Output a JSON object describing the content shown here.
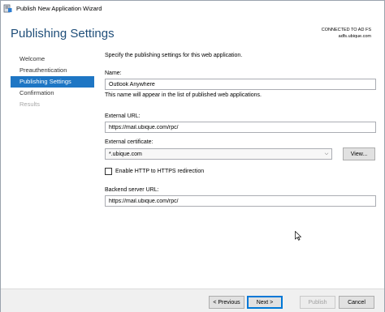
{
  "window": {
    "title": "Publish New Application Wizard"
  },
  "header": {
    "page_title": "Publishing Settings",
    "connection_status": "CONNECTED TO AD FS",
    "connection_host": "adfs.ubique.com"
  },
  "sidebar": {
    "items": [
      {
        "label": "Welcome",
        "state": "normal"
      },
      {
        "label": "Preauthentication",
        "state": "normal"
      },
      {
        "label": "Publishing Settings",
        "state": "active"
      },
      {
        "label": "Confirmation",
        "state": "normal"
      },
      {
        "label": "Results",
        "state": "disabled"
      }
    ]
  },
  "form": {
    "intro": "Specify the publishing settings for this web application.",
    "name_label": "Name:",
    "name_value": "Outlook Anywhere",
    "name_hint": "This name will appear in the list of published web applications.",
    "external_url_label": "External URL:",
    "external_url_value": "https://mail.ubique.com/rpc/",
    "certificate_label": "External certificate:",
    "certificate_value": "*.ubique.com",
    "view_button": "View...",
    "redirect_label": "Enable HTTP to HTTPS redirection",
    "redirect_checked": false,
    "backend_url_label": "Backend server URL:",
    "backend_url_value": "https://mail.ubique.com/rpc/"
  },
  "footer": {
    "previous": "< Previous",
    "next": "Next >",
    "publish": "Publish",
    "cancel": "Cancel"
  },
  "colors": {
    "accent": "#1e76c4",
    "title": "#1f4e79"
  }
}
